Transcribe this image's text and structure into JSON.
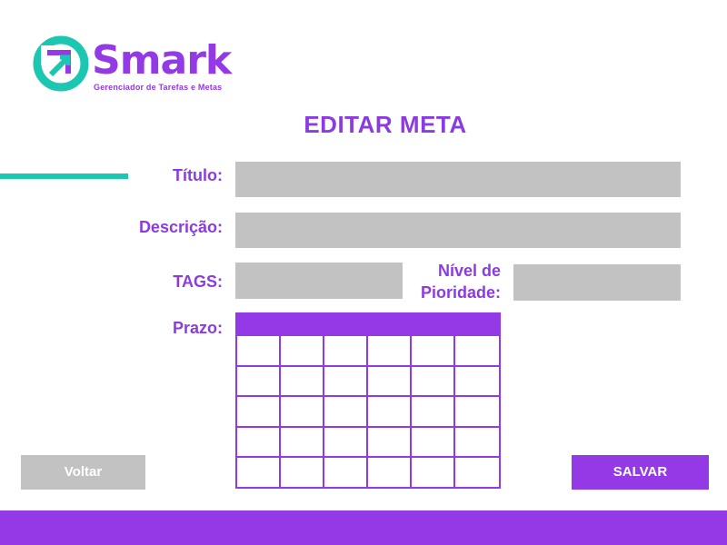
{
  "brand": {
    "name": "Smark",
    "tagline": "Gerenciador de Tarefas e Metas",
    "icon": "arrow-up-right-in-circle-icon",
    "colors": {
      "primary": "#9339e6",
      "accent": "#1bc7b1"
    }
  },
  "page": {
    "title": "EDITAR META"
  },
  "form": {
    "titulo_label": "Título:",
    "descricao_label": "Descrição:",
    "tags_label": "TAGS:",
    "prioridade_label_line1": "Nível de",
    "prioridade_label_line2": "Pioridade:",
    "prazo_label": "Prazo:"
  },
  "calendar": {
    "rows": 5,
    "cols": 6
  },
  "actions": {
    "back_label": "Voltar",
    "save_label": "SALVAR"
  },
  "colors": {
    "field_bg": "#c2c2c2",
    "footer": "#9339e6"
  }
}
